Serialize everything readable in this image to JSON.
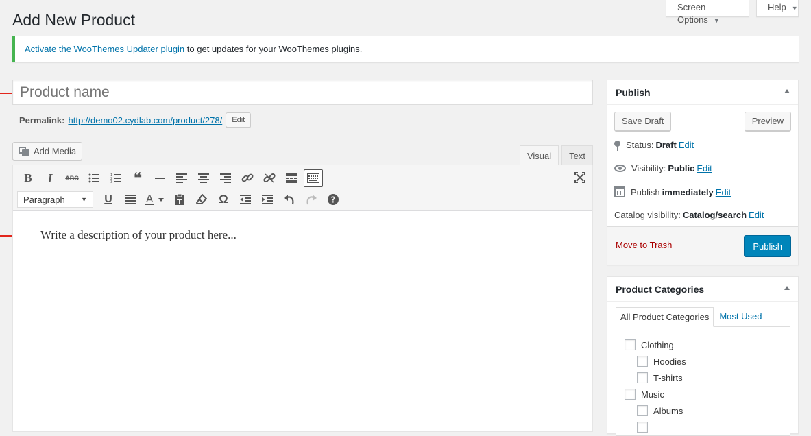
{
  "screen_meta": {
    "screen_options": "Screen Options",
    "help": "Help"
  },
  "page": {
    "title": "Add New Product"
  },
  "notice": {
    "link_text": "Activate the WooThemes Updater plugin",
    "rest": " to get updates for your WooThemes plugins."
  },
  "title_field": {
    "placeholder": "Product name"
  },
  "permalink": {
    "label": "Permalink:",
    "url": "http://demo02.cydlab.com/product/278/",
    "edit": "Edit"
  },
  "media": {
    "add_media": "Add Media"
  },
  "editor": {
    "tabs": {
      "visual": "Visual",
      "text": "Text"
    },
    "format_select": "Paragraph",
    "placeholder": "Write a description of your product here..."
  },
  "publish": {
    "title": "Publish",
    "save_draft": "Save Draft",
    "preview": "Preview",
    "status_label": "Status:",
    "status_value": "Draft",
    "visibility_label": "Visibility:",
    "visibility_value": "Public",
    "publish_label": "Publish",
    "publish_value": "immediately",
    "catalog_label": "Catalog visibility:",
    "catalog_value": "Catalog/search",
    "edit": "Edit",
    "trash": "Move to Trash",
    "publish_button": "Publish"
  },
  "categories": {
    "title": "Product Categories",
    "tab_all": "All Product Categories",
    "tab_used": "Most Used",
    "items": [
      {
        "label": "Clothing"
      },
      {
        "label": "Hoodies"
      },
      {
        "label": "T-shirts"
      },
      {
        "label": "Music"
      },
      {
        "label": "Albums"
      }
    ]
  },
  "colors": {
    "accent": "#0085ba",
    "notice_border": "#46b450",
    "link": "#0073aa",
    "arrow": "#e2261c"
  }
}
